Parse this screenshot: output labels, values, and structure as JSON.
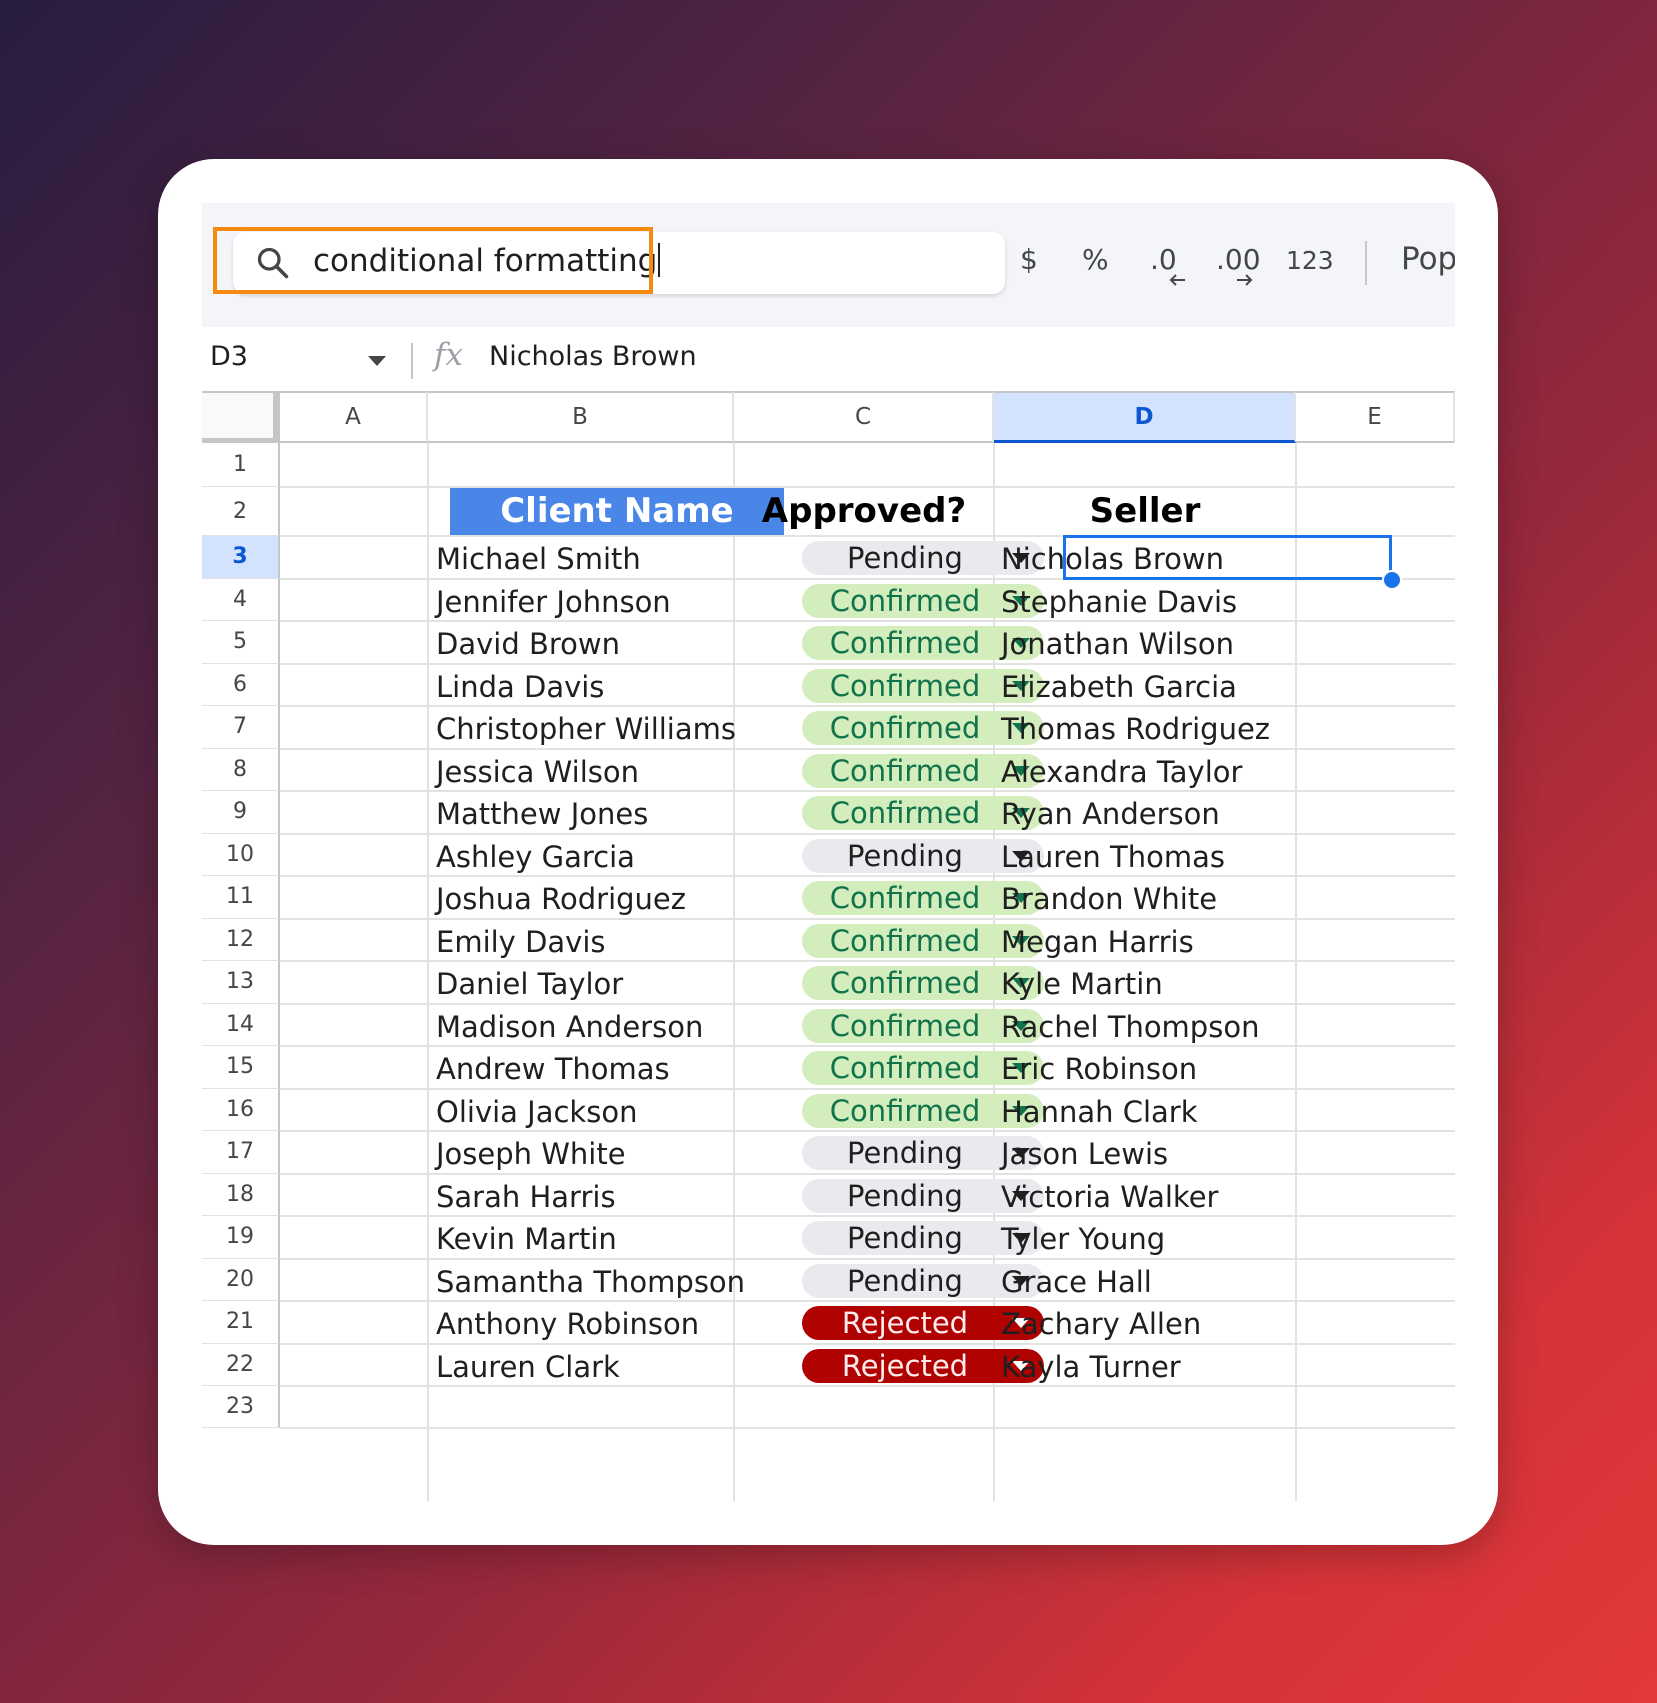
{
  "search": {
    "value": "conditional formatting"
  },
  "toolbar": {
    "currency": "$",
    "percent": "%",
    "decrease_decimal": ".0",
    "increase_decimal": ".00",
    "number_format": "123",
    "font_partial": "Pop"
  },
  "formula_bar": {
    "cell_ref": "D3",
    "fx": "fx",
    "value": "Nicholas Brown"
  },
  "columns": [
    "A",
    "B",
    "C",
    "D",
    "E"
  ],
  "selected_column": "D",
  "row_numbers": [
    "1",
    "2",
    "3",
    "4",
    "5",
    "6",
    "7",
    "8",
    "9",
    "10",
    "11",
    "12",
    "13",
    "14",
    "15",
    "16",
    "17",
    "18",
    "19",
    "20",
    "21",
    "22",
    "23"
  ],
  "selected_row": "3",
  "headers": {
    "client": "Client Name",
    "approved": "Approved?",
    "seller": "Seller"
  },
  "rows": [
    {
      "client": "Michael Smith",
      "status": "Pending",
      "seller": "Nicholas Brown"
    },
    {
      "client": "Jennifer Johnson",
      "status": "Confirmed",
      "seller": "Stephanie Davis"
    },
    {
      "client": "David Brown",
      "status": "Confirmed",
      "seller": "Jonathan Wilson"
    },
    {
      "client": "Linda Davis",
      "status": "Confirmed",
      "seller": "Elizabeth Garcia"
    },
    {
      "client": "Christopher Williams",
      "status": "Confirmed",
      "seller": "Thomas Rodriguez"
    },
    {
      "client": "Jessica Wilson",
      "status": "Confirmed",
      "seller": "Alexandra Taylor"
    },
    {
      "client": "Matthew Jones",
      "status": "Confirmed",
      "seller": "Ryan Anderson"
    },
    {
      "client": "Ashley Garcia",
      "status": "Pending",
      "seller": "Lauren Thomas"
    },
    {
      "client": "Joshua Rodriguez",
      "status": "Confirmed",
      "seller": "Brandon White"
    },
    {
      "client": "Emily Davis",
      "status": "Confirmed",
      "seller": "Megan Harris"
    },
    {
      "client": "Daniel Taylor",
      "status": "Confirmed",
      "seller": "Kyle Martin"
    },
    {
      "client": "Madison Anderson",
      "status": "Confirmed",
      "seller": "Rachel Thompson"
    },
    {
      "client": "Andrew Thomas",
      "status": "Confirmed",
      "seller": "Eric Robinson"
    },
    {
      "client": "Olivia Jackson",
      "status": "Confirmed",
      "seller": "Hannah Clark"
    },
    {
      "client": "Joseph White",
      "status": "Pending",
      "seller": "Jason Lewis"
    },
    {
      "client": "Sarah Harris",
      "status": "Pending",
      "seller": "Victoria Walker"
    },
    {
      "client": "Kevin Martin",
      "status": "Pending",
      "seller": "Tyler Young"
    },
    {
      "client": "Samantha Thompson",
      "status": "Pending",
      "seller": "Grace Hall"
    },
    {
      "client": "Anthony Robinson",
      "status": "Rejected",
      "seller": "Zachary Allen"
    },
    {
      "client": "Lauren Clark",
      "status": "Rejected",
      "seller": "Kayla Turner"
    }
  ],
  "colors": {
    "accent": "#1a73e8",
    "header_blue": "#4a86e8",
    "confirmed_bg": "#d4edbc",
    "confirmed_text": "#11734b",
    "pending_bg": "#e8eaed",
    "rejected_bg": "#b10202",
    "highlight_orange": "#f58a11"
  }
}
